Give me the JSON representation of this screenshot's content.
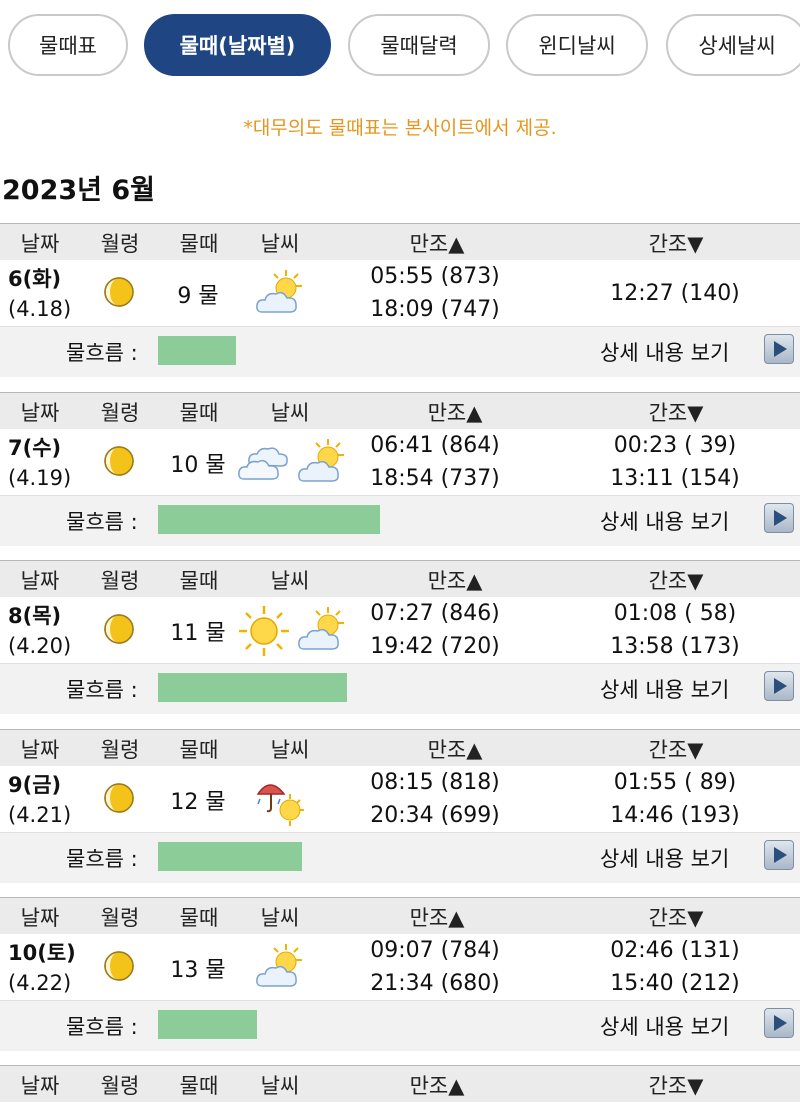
{
  "tabs": [
    "물때표",
    "물때(날짜별)",
    "물때달력",
    "윈디날씨",
    "상세날씨"
  ],
  "notice": "*대무의도 물때표는 본사이트에서 제공.",
  "month_title": "2023년 6월",
  "headers": {
    "date": "날짜",
    "moon": "월령",
    "tide": "물때",
    "weather": "날씨",
    "high": "만조",
    "high_mark": "▲",
    "low": "간조",
    "low_mark": "▼"
  },
  "flow_label": "물흐름 :",
  "detail_label": "상세 내용 보기",
  "days": [
    {
      "day": "6(화)",
      "lunar": "(4.18)",
      "tide": "9 물",
      "weather": [
        "partly-cloudy-icon"
      ],
      "high": [
        "05:55 (873)",
        "18:09 (747)"
      ],
      "low": [
        "12:27 (140)"
      ],
      "flow": 0.26
    },
    {
      "day": "7(수)",
      "lunar": "(4.19)",
      "tide": "10 물",
      "weather": [
        "cloudy-icon",
        "partly-cloudy-icon"
      ],
      "high": [
        "06:41 (864)",
        "18:54 (737)"
      ],
      "low": [
        "00:23 ( 39)",
        "13:11 (154)"
      ],
      "flow": 0.74
    },
    {
      "day": "8(목)",
      "lunar": "(4.20)",
      "tide": "11 물",
      "weather": [
        "sunny-icon",
        "partly-cloudy-icon"
      ],
      "high": [
        "07:27 (846)",
        "19:42 (720)"
      ],
      "low": [
        "01:08 ( 58)",
        "13:58 (173)"
      ],
      "flow": 0.63
    },
    {
      "day": "9(금)",
      "lunar": "(4.21)",
      "tide": "12 물",
      "weather": [
        "rain-sun-icon"
      ],
      "high": [
        "08:15 (818)",
        "20:34 (699)"
      ],
      "low": [
        "01:55 ( 89)",
        "14:46 (193)"
      ],
      "flow": 0.48
    },
    {
      "day": "10(토)",
      "lunar": "(4.22)",
      "tide": "13 물",
      "weather": [
        "partly-cloudy-icon"
      ],
      "high": [
        "09:07 (784)",
        "21:34 (680)"
      ],
      "low": [
        "02:46 (131)",
        "15:40 (212)"
      ],
      "flow": 0.33
    }
  ]
}
